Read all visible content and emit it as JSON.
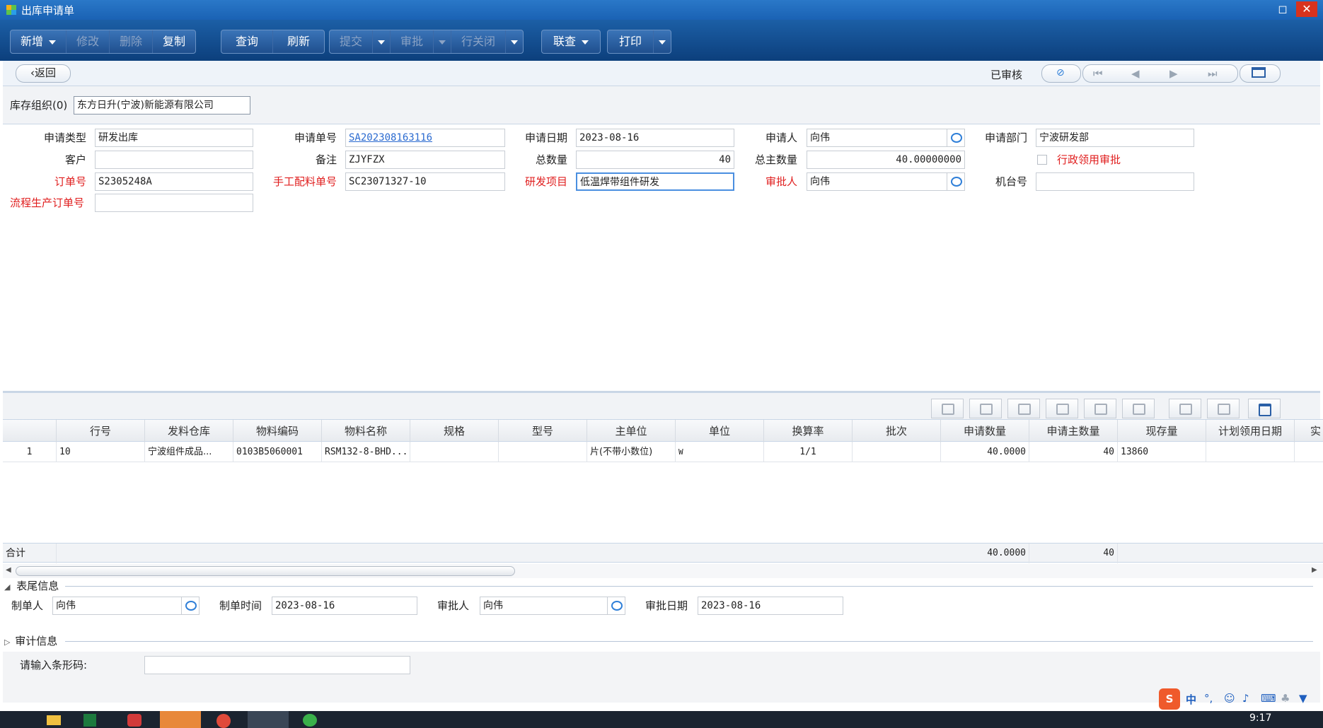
{
  "window": {
    "title": "出库申请单",
    "restore_label": "◻",
    "close_label": "✕"
  },
  "toolbar": {
    "add": "新增",
    "modify": "修改",
    "delete": "删除",
    "copy": "复制",
    "query": "查询",
    "refresh": "刷新",
    "submit": "提交",
    "approve": "审批",
    "row_close": "行关闭",
    "link_query": "联查",
    "print": "打印"
  },
  "nav": {
    "back": "返回",
    "status": "已审核"
  },
  "org": {
    "label": "库存组织(0)",
    "value": "东方日升(宁波)新能源有限公司"
  },
  "form": {
    "apply_type_label": "申请类型",
    "apply_type": "研发出库",
    "apply_no_label": "申请单号",
    "apply_no": "SA202308163116",
    "apply_date_label": "申请日期",
    "apply_date": "2023-08-16",
    "applicant_label": "申请人",
    "applicant": "向伟",
    "apply_dept_label": "申请部门",
    "apply_dept": "宁波研发部",
    "customer_label": "客户",
    "customer": "",
    "remark_label": "备注",
    "remark": "ZJYFZX",
    "total_qty_label": "总数量",
    "total_qty": "40",
    "total_main_qty_label": "总主数量",
    "total_main_qty": "40.00000000",
    "admin_approval_label": "行政领用审批",
    "order_no_label": "订单号",
    "order_no": "S2305248A",
    "manual_no_label": "手工配料单号",
    "manual_no": "SC23071327-10",
    "rd_project_label": "研发项目",
    "rd_project": "低温焊带组件研发",
    "approver_label": "审批人",
    "approver": "向伟",
    "machine_no_label": "机台号",
    "machine_no": "",
    "flow_order_label": "流程生产订单号",
    "flow_order": ""
  },
  "grid": {
    "headers": [
      "行号",
      "发料仓库",
      "物料编码",
      "物料名称",
      "规格",
      "型号",
      "主单位",
      "单位",
      "换算率",
      "批次",
      "申请数量",
      "申请主数量",
      "现存量",
      "计划领用日期",
      "实"
    ],
    "row": {
      "idx": "1",
      "line": "10",
      "warehouse": "宁波组件成品...",
      "code": "0103B5060001",
      "name": "RSM132-8-BHD...",
      "spec": "",
      "model": "",
      "main_unit": "片(不带小数位)",
      "unit": "W",
      "rate": "1/1",
      "batch": "",
      "qty": "40.0000",
      "main_qty": "40",
      "stock": "13860",
      "plan_date": ""
    },
    "total": {
      "label": "合计",
      "qty": "40.0000",
      "main_qty": "40"
    }
  },
  "footer": {
    "section_label": "表尾信息",
    "maker_label": "制单人",
    "maker": "向伟",
    "make_time_label": "制单时间",
    "make_time": "2023-08-16",
    "approver_label": "审批人",
    "approver": "向伟",
    "approve_date_label": "审批日期",
    "approve_date": "2023-08-16",
    "audit_label": "审计信息",
    "barcode_label": "请输入条形码:",
    "barcode": ""
  },
  "taskbar": {
    "clock": "9:17"
  },
  "colors": {
    "toolbar": "#1c5fa6",
    "required": "#e01e1e",
    "stock_header": "#1fb81f",
    "link": "#2a6ad0"
  }
}
